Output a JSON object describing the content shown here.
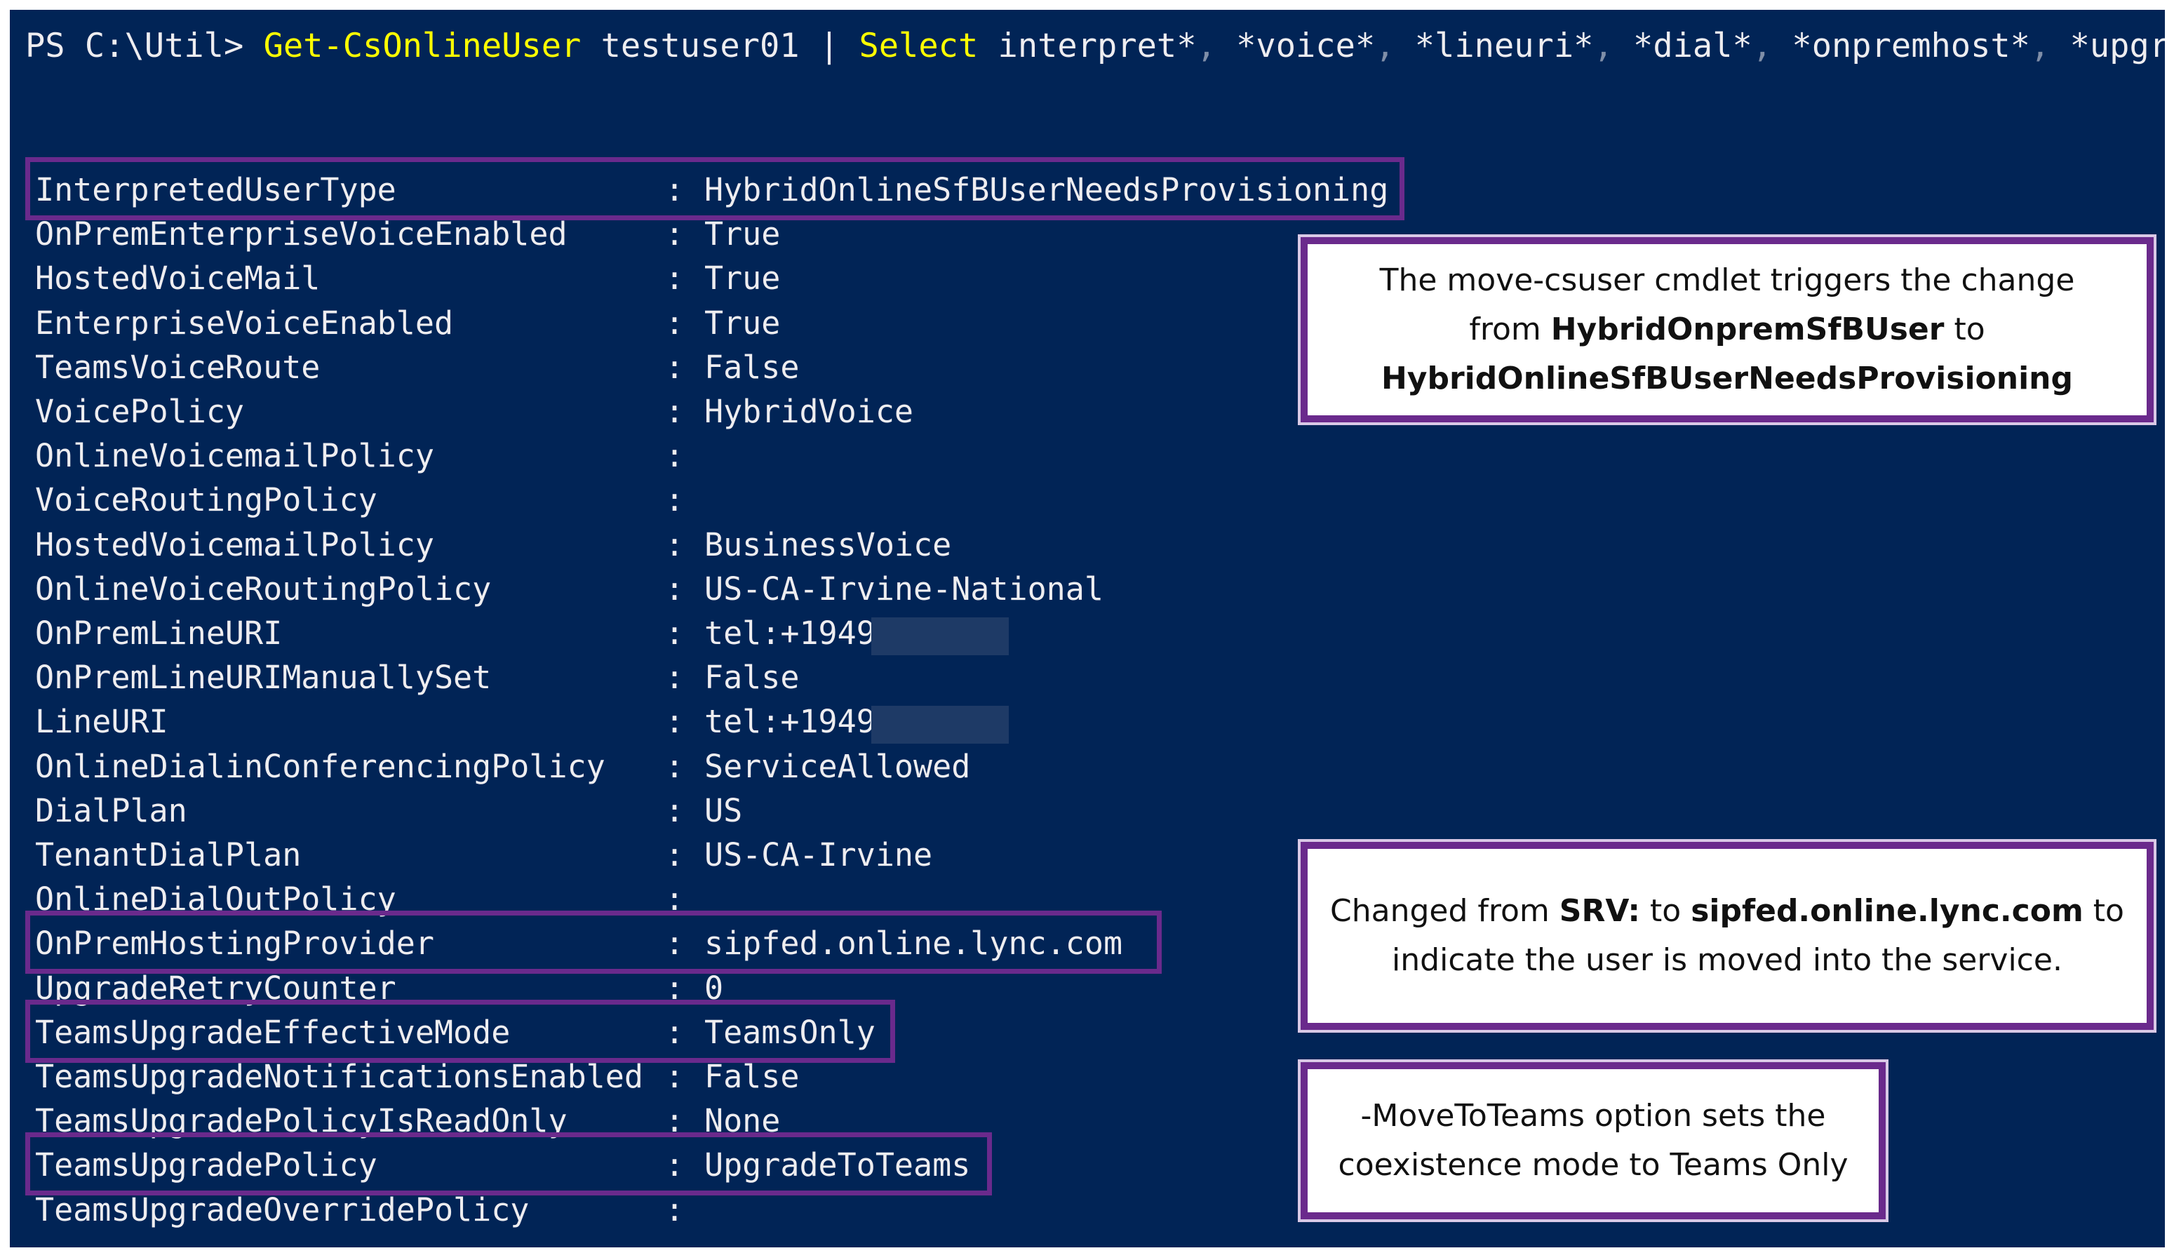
{
  "console": {
    "prompt": "PS C:\\Util>",
    "command": "Get-CsOnlineUser",
    "argument": "testuser01",
    "pipe": "|",
    "select_cmd": "Select",
    "select_args": [
      {
        "text": "interpret*",
        "sep": ","
      },
      {
        "text": "*voice*",
        "sep": ","
      },
      {
        "text": "*lineuri*",
        "sep": ","
      },
      {
        "text": "*dial*",
        "sep": ","
      },
      {
        "text": "*onpremhost*",
        "sep": ","
      },
      {
        "text": "*upgrade*",
        "sep": ""
      }
    ],
    "colon": ":",
    "properties": [
      {
        "key": "InterpretedUserType",
        "value": "HybridOnlineSfBUserNeedsProvisioning",
        "highlight": true
      },
      {
        "key": "OnPremEnterpriseVoiceEnabled",
        "value": "True"
      },
      {
        "key": "HostedVoiceMail",
        "value": "True"
      },
      {
        "key": "EnterpriseVoiceEnabled",
        "value": "True"
      },
      {
        "key": "TeamsVoiceRoute",
        "value": "False"
      },
      {
        "key": "VoicePolicy",
        "value": "HybridVoice"
      },
      {
        "key": "OnlineVoicemailPolicy",
        "value": ""
      },
      {
        "key": "VoiceRoutingPolicy",
        "value": ""
      },
      {
        "key": "HostedVoicemailPolicy",
        "value": "BusinessVoice"
      },
      {
        "key": "OnlineVoiceRoutingPolicy",
        "value": "US-CA-Irvine-National"
      },
      {
        "key": "OnPremLineURI",
        "value": "tel:+1949",
        "redacted": true
      },
      {
        "key": "OnPremLineURIManuallySet",
        "value": "False"
      },
      {
        "key": "LineURI",
        "value": "tel:+1949",
        "redacted": true
      },
      {
        "key": "OnlineDialinConferencingPolicy",
        "value": "ServiceAllowed"
      },
      {
        "key": "DialPlan",
        "value": "US"
      },
      {
        "key": "TenantDialPlan",
        "value": "US-CA-Irvine"
      },
      {
        "key": "OnlineDialOutPolicy",
        "value": ""
      },
      {
        "key": "OnPremHostingProvider",
        "value": "sipfed.online.lync.com",
        "highlight": true
      },
      {
        "key": "UpgradeRetryCounter",
        "value": "0"
      },
      {
        "key": "TeamsUpgradeEffectiveMode",
        "value": "TeamsOnly",
        "highlight": true
      },
      {
        "key": "TeamsUpgradeNotificationsEnabled",
        "value": "False"
      },
      {
        "key": "TeamsUpgradePolicyIsReadOnly",
        "value": "None"
      },
      {
        "key": "TeamsUpgradePolicy",
        "value": "UpgradeToTeams",
        "highlight": true
      },
      {
        "key": "TeamsUpgradeOverridePolicy",
        "value": ""
      }
    ]
  },
  "callouts": {
    "move_csuser": {
      "t1": "The move-csuser cmdlet triggers the change",
      "t2": "from ",
      "b1": "HybridOnpremSfBUser",
      "t3": " to",
      "b2": "HybridOnlineSfBUserNeedsProvisioning"
    },
    "hosting_provider": {
      "t1": "Changed from ",
      "b1": "SRV:",
      "t2": " to ",
      "b2": "sipfed.online.lync.com",
      "t3": " to",
      "t4": "indicate the user is moved into the service."
    },
    "move_to_teams": {
      "t1": "-MoveToTeams option sets the",
      "t2": "coexistence mode to Teams Only"
    }
  },
  "colors": {
    "console_bg": "#012456",
    "command_yellow": "#ffff00",
    "highlight_purple": "#6a2a8c"
  }
}
